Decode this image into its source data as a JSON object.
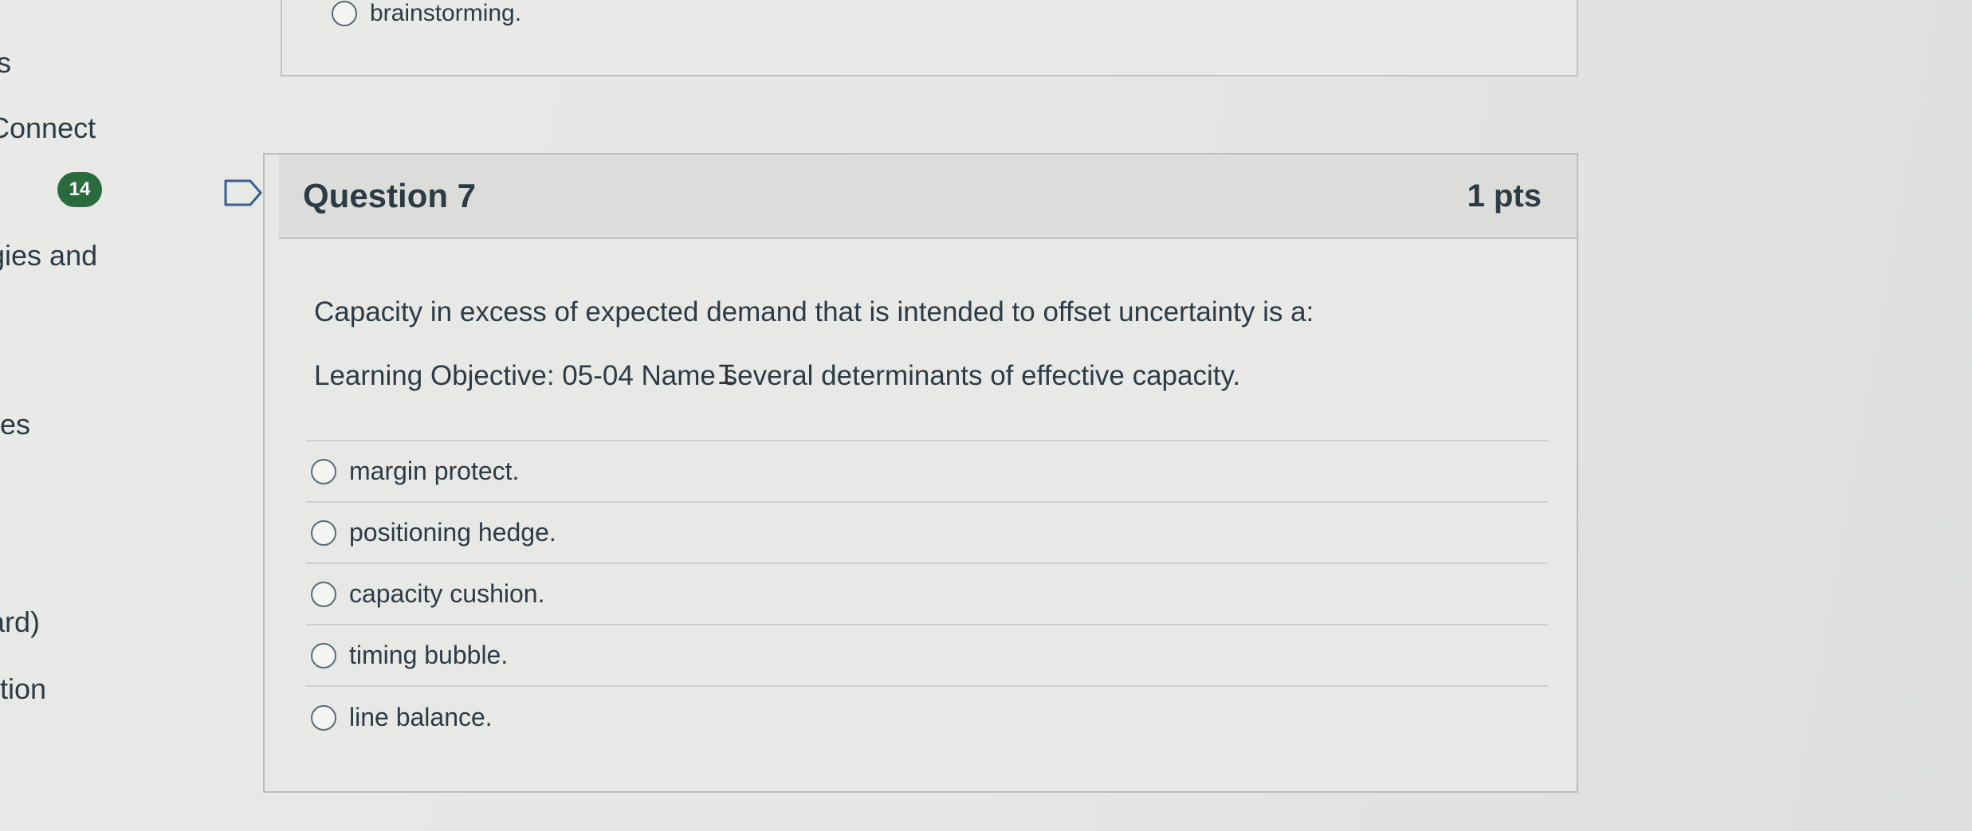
{
  "nav": {
    "items": [
      "ts",
      "Connect",
      "gies and",
      "es",
      "ard)",
      "tion"
    ],
    "badge_count": "14"
  },
  "prev_question": {
    "last_option": "brainstorming."
  },
  "question": {
    "title": "Question 7",
    "points": "1 pts",
    "text": "Capacity in excess of expected demand that is intended to offset uncertainty is a:",
    "objective": "Learning Objective: 05-04 Name several determinants of effective capacity.",
    "answers": [
      {
        "label": "margin protect."
      },
      {
        "label": "positioning hedge."
      },
      {
        "label": "capacity cushion."
      },
      {
        "label": "timing bubble."
      },
      {
        "label": "line balance."
      }
    ]
  },
  "icons": {
    "flag": "flag-outline-icon",
    "radio": "radio-unselected-icon",
    "cursor": "text-cursor-icon"
  }
}
